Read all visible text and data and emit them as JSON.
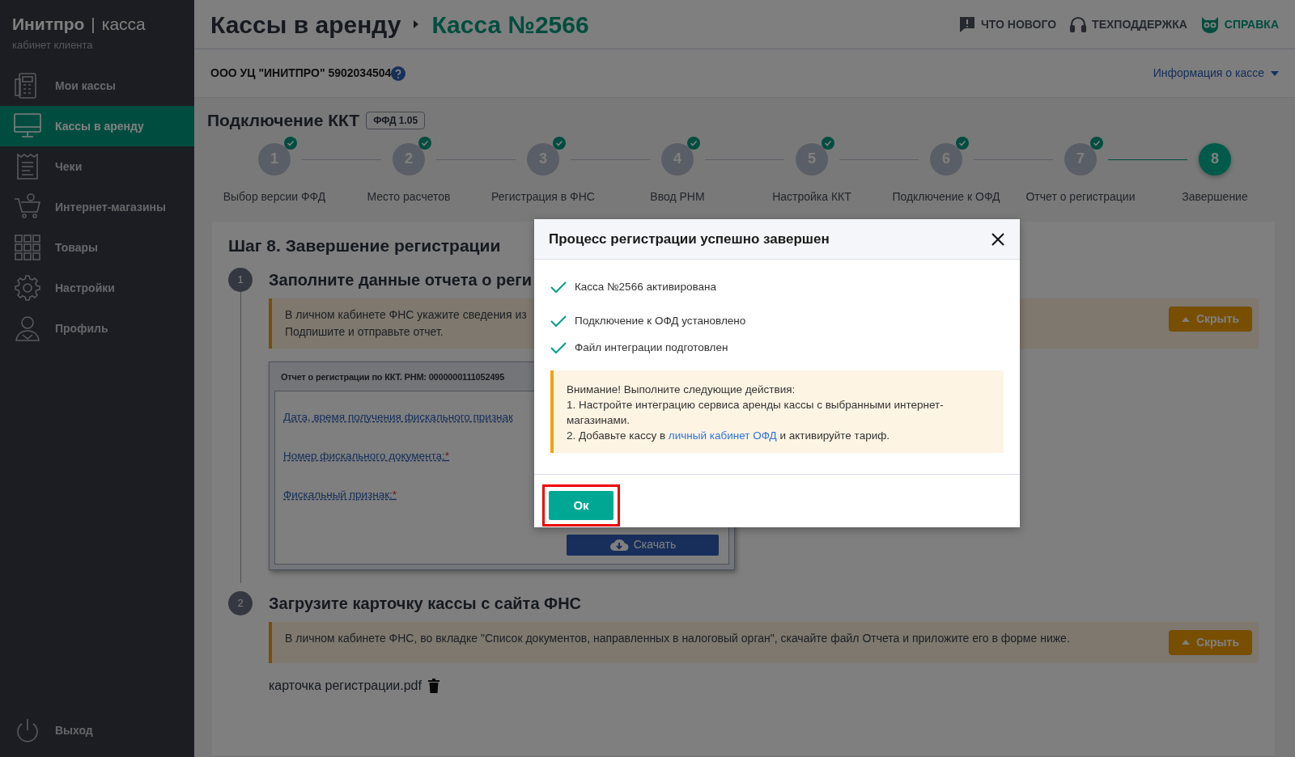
{
  "brand": {
    "name": "Инитпро",
    "separator": "|",
    "product": "касса",
    "subtitle": "кабинет клиента"
  },
  "sidebar": {
    "items": [
      {
        "label": "Мои кассы",
        "kind": "register",
        "selected": false
      },
      {
        "label": "Кассы в аренду",
        "kind": "monitor",
        "selected": true
      },
      {
        "label": "Чеки",
        "kind": "receipt",
        "selected": false
      },
      {
        "label": "Интернет-магазины",
        "kind": "cart",
        "selected": false
      },
      {
        "label": "Товары",
        "kind": "grid",
        "selected": false
      },
      {
        "label": "Настройки",
        "kind": "gear",
        "selected": false
      },
      {
        "label": "Профиль",
        "kind": "person",
        "selected": false
      }
    ],
    "logout": "Выход"
  },
  "header": {
    "breadcrumb": [
      "Кассы в аренду",
      "Касса №2566"
    ],
    "links": [
      {
        "label": "ЧТО НОВОГО",
        "kind": "news"
      },
      {
        "label": "ТЕХПОДДЕРЖКА",
        "kind": "support"
      },
      {
        "label": "СПРАВКА",
        "kind": "help"
      }
    ]
  },
  "org": {
    "name": "ООО УЦ \"ИНИТПРО\" 5902034504",
    "info_menu": "Информация о кассе"
  },
  "connection": {
    "title": "Подключение ККТ",
    "badge": "ФФД 1.05",
    "steps": [
      {
        "number": "1",
        "label": "Выбор версии ФФД",
        "done": true,
        "selected": false
      },
      {
        "number": "2",
        "label": "Место расчетов",
        "done": true,
        "selected": false
      },
      {
        "number": "3",
        "label": "Регистрация в ФНС",
        "done": true,
        "selected": false
      },
      {
        "number": "4",
        "label": "Ввод РНМ",
        "done": true,
        "selected": false
      },
      {
        "number": "5",
        "label": "Настройка ККТ",
        "done": true,
        "selected": false
      },
      {
        "number": "6",
        "label": "Подключение к ОФД",
        "done": true,
        "selected": false
      },
      {
        "number": "7",
        "label": "Отчет о регистрации",
        "done": true,
        "selected": false
      },
      {
        "number": "8",
        "label": "Завершение",
        "done": false,
        "selected": true
      }
    ]
  },
  "step_card": {
    "title": "Шаг 8. Завершение регистрации",
    "sections": [
      {
        "number": "1",
        "title": "Заполните данные отчета о реги",
        "alert": {
          "lines": [
            "В личном кабинете ФНС укажите сведения из",
            "Подпишите и отправьте отчет."
          ],
          "hide_button": "Скрыть"
        },
        "report": {
          "title": "Отчет о регистрации по ККТ. РНМ: 0000000111052495",
          "fields": [
            {
              "label": "Дата, время получения фискального признак"
            },
            {
              "label": "Номер фискального документа:",
              "mark": "*"
            },
            {
              "label": "Фискальный признак:",
              "mark": "*"
            }
          ],
          "download_button": "Скачать"
        }
      },
      {
        "number": "2",
        "title": "Загрузите карточку кассы с сайта ФНС",
        "alert": {
          "lines": [
            "В личном кабинете ФНС, во вкладке \"Список документов, направленных в налоговый орган\", скачайте файл Отчета и приложите его в форме ниже."
          ],
          "hide_button": "Скрыть"
        },
        "file": "карточка регистрации.pdf"
      }
    ]
  },
  "modal": {
    "title": "Процесс регистрации успешно завершен",
    "checks": [
      "Касса №2566 активирована",
      "Подключение к ОФД установлено",
      "Файл интеграции подготовлен"
    ],
    "notice": {
      "lines": [
        {
          "text": "Внимание! Выполните следующие действия:"
        },
        {
          "text": "1. Настройте интеграцию сервиса аренды кассы с выбранными интернет-магазинами."
        },
        {
          "text": "2. Добавьте кассу в ",
          "link": "личный кабинет ОФД",
          "after": " и активируйте тариф."
        }
      ]
    },
    "ok_button": {
      "label": "Ок",
      "highlighted": true
    }
  }
}
